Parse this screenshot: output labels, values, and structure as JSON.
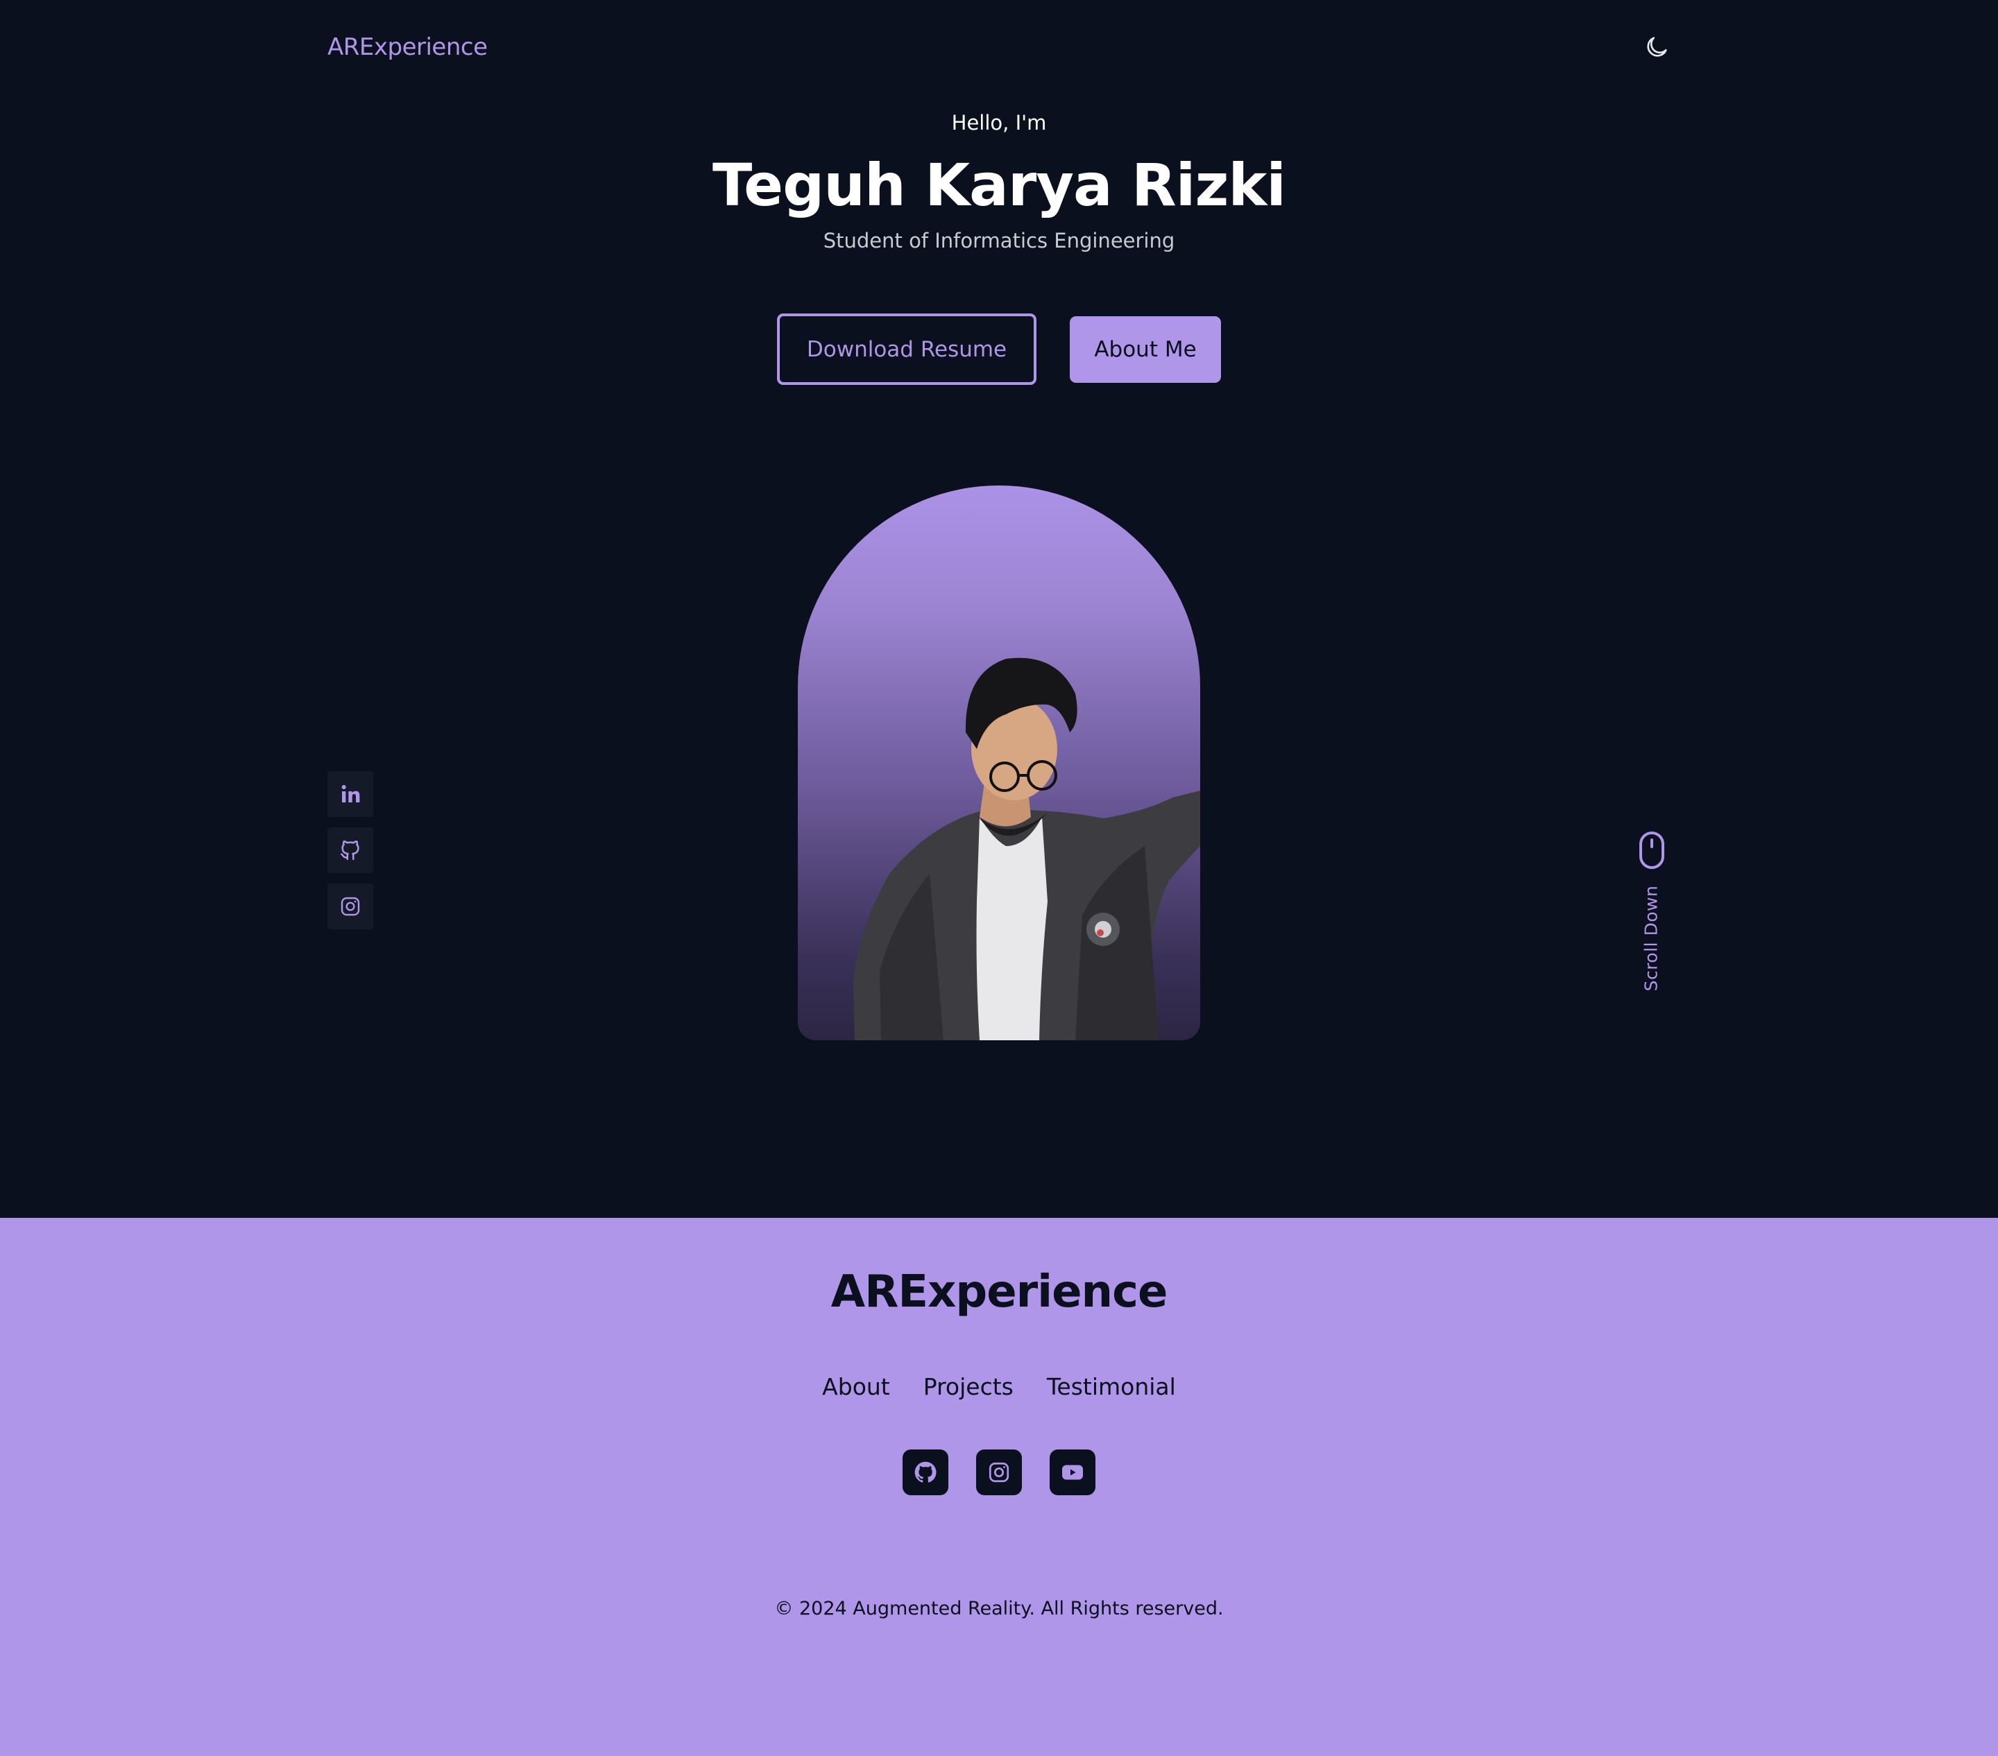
{
  "header": {
    "brand": "ARExperience",
    "theme_toggle_icon": "moon-icon"
  },
  "hero": {
    "greeting": "Hello, I'm",
    "name": "Teguh Karya Rizki",
    "subtitle": "Student of Informatics Engineering",
    "download_label": "Download Resume",
    "about_label": "About Me",
    "portrait_icon": "person-photo"
  },
  "social_rail": [
    {
      "icon": "linkedin-icon"
    },
    {
      "icon": "github-icon"
    },
    {
      "icon": "instagram-icon"
    }
  ],
  "scroll": {
    "label": "Scroll Down",
    "icon": "mouse-icon"
  },
  "footer": {
    "brand": "ARExperience",
    "nav": [
      "About",
      "Projects",
      "Testimonial"
    ],
    "social": [
      {
        "icon": "github-icon"
      },
      {
        "icon": "instagram-icon"
      },
      {
        "icon": "youtube-icon"
      }
    ],
    "copyright": "© 2024 Augmented Reality. All Rights reserved."
  },
  "colors": {
    "background": "#0b101e",
    "accent": "#b096e8",
    "text": "#ffffff",
    "muted": "#c9cbd3"
  }
}
